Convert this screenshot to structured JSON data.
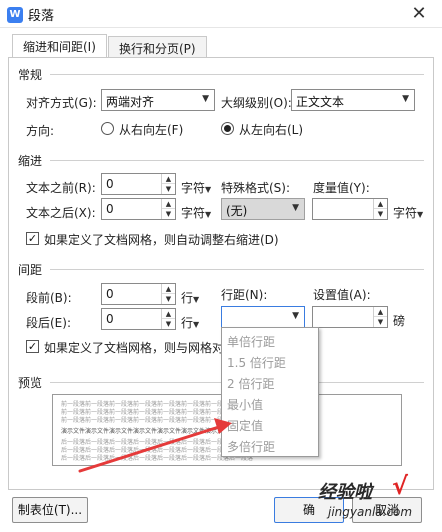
{
  "window": {
    "title": "段落",
    "close": "✕",
    "app_icon": "W"
  },
  "tabs": [
    {
      "label": "缩进和间距(I)"
    },
    {
      "label": "换行和分页(P)"
    }
  ],
  "general": {
    "heading": "常规",
    "alignment_label": "对齐方式(G):",
    "alignment_value": "两端对齐",
    "outline_label": "大纲级别(O):",
    "outline_value": "正文文本",
    "direction_label": "方向:",
    "rtl_label": "从右向左(F)",
    "ltr_label": "从左向右(L)"
  },
  "indent": {
    "heading": "缩进",
    "before_label": "文本之前(R):",
    "before_value": "0",
    "after_label": "文本之后(X):",
    "after_value": "0",
    "unit": "字符",
    "special_label": "特殊格式(S):",
    "special_value": "(无)",
    "measure_label": "度量值(Y):",
    "measure_value": "",
    "measure_unit": "字符",
    "grid_check_label": "如果定义了文档网格，则自动调整右缩进(D)"
  },
  "spacing": {
    "heading": "间距",
    "before_label": "段前(B):",
    "before_value": "0",
    "after_label": "段后(E):",
    "after_value": "0",
    "unit": "行",
    "line_label": "行距(N):",
    "line_value": "",
    "setvalue_label": "设置值(A):",
    "setvalue_value": "",
    "setvalue_unit": "磅",
    "grid_check_label": "如果定义了文档网格，则与网格对"
  },
  "line_spacing_options": [
    "单倍行距",
    "1.5 倍行距",
    "2 倍行距",
    "最小值",
    "固定值",
    "多倍行距"
  ],
  "preview": {
    "heading": "预览",
    "prev_text": "前一段落前一段落前一段落前一段落前一段落前一段落前一段落前一段落",
    "sample_text": "演示文件演示文件演示文件演示文件演示文件演示文件演示文件演示",
    "next_text": "后一段落后一段落后一段落后一段落后一段落后一段落后一段落后一段落"
  },
  "buttons": {
    "tabs_label": "制表位(T)...",
    "ok_label": "确",
    "cancel_label": "取消"
  },
  "watermark": {
    "logo": "经验啦",
    "check": "√",
    "url": "jingyanla.com"
  },
  "colors": {
    "accent": "#3a7ce0",
    "arrow": "#e53a3a"
  }
}
